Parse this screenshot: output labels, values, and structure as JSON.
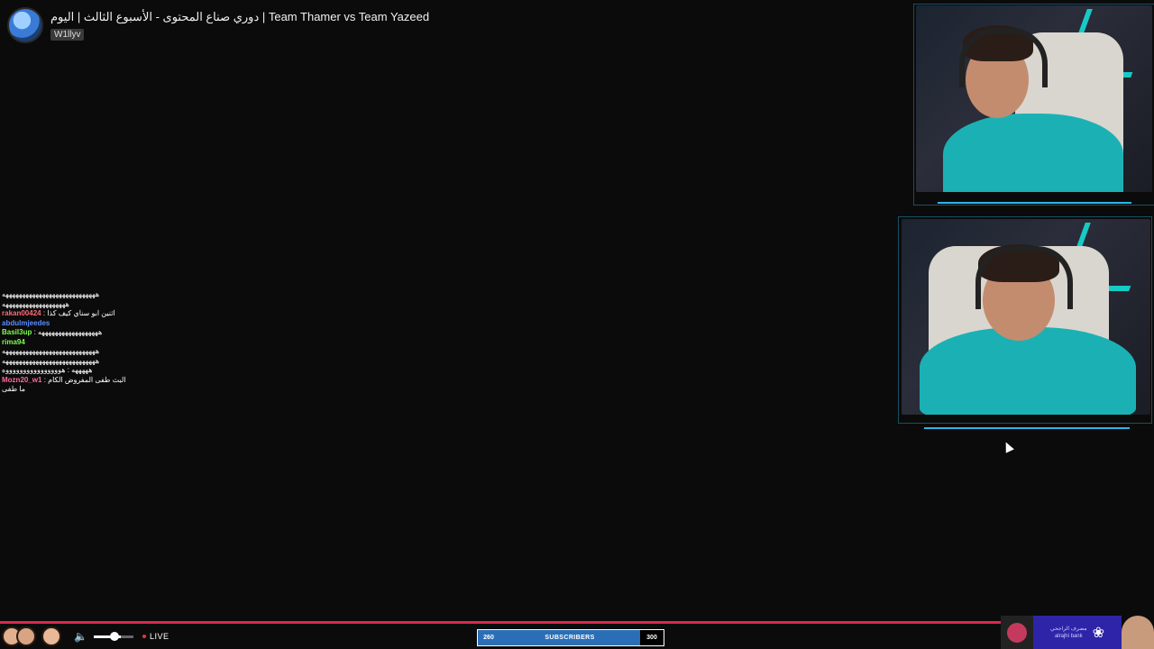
{
  "header": {
    "title": "دوري صناع المحتوى - الأسبوع الثالث | اليوم | Team Thamer vs Team Yazeed",
    "channel": "W1llyv"
  },
  "chat": [
    {
      "user": "",
      "user_color": "#bbbbbb",
      "msg": "ههههههههههههههههههههههههههههه"
    },
    {
      "user": "",
      "user_color": "#aaaaaa",
      "msg": "هههههههههههههههههههه"
    },
    {
      "user": "rakan00424",
      "user_color": "#ff6a7a",
      "msg": "اثنين ابو سناي كيف كذا"
    },
    {
      "user": "abdulmjeedes",
      "user_color": "#5b8cff",
      "msg": ""
    },
    {
      "user": "Basil3up",
      "user_color": "#7cff4d",
      "msg": "ههههههههههههههههههه"
    },
    {
      "user": "rima94",
      "user_color": "#7cff4d",
      "msg": ""
    },
    {
      "user": "",
      "user_color": "#aaaaaa",
      "msg": "ههههههههههههههههههههههههههههه"
    },
    {
      "user": "",
      "user_color": "#aaaaaa",
      "msg": "ههههههههههههههههههههههههههههه"
    },
    {
      "user": "",
      "user_color": "#aaaaaa",
      "msg": "هههههه : هووووووووووووووووه"
    },
    {
      "user": "Mozn20_w1",
      "user_color": "#ff6a9a",
      "msg": "البث طفى المفروض الكام"
    },
    {
      "user": "",
      "user_color": "#aaaaaa",
      "msg": "ما طفى"
    }
  ],
  "player": {
    "live_label": "LIVE"
  },
  "subscribers": {
    "current": "260",
    "label": "SUBSCRIBERS",
    "goal": "300"
  },
  "sponsor": {
    "bank_ar": "مصرف الراجحي",
    "bank_en": "alrajhi bank"
  },
  "colors": {
    "accent_line": "#e0244f",
    "sub_bar": "#2a6fb6",
    "neon": "#14e7e0",
    "bank_bg": "#2d24a8"
  }
}
